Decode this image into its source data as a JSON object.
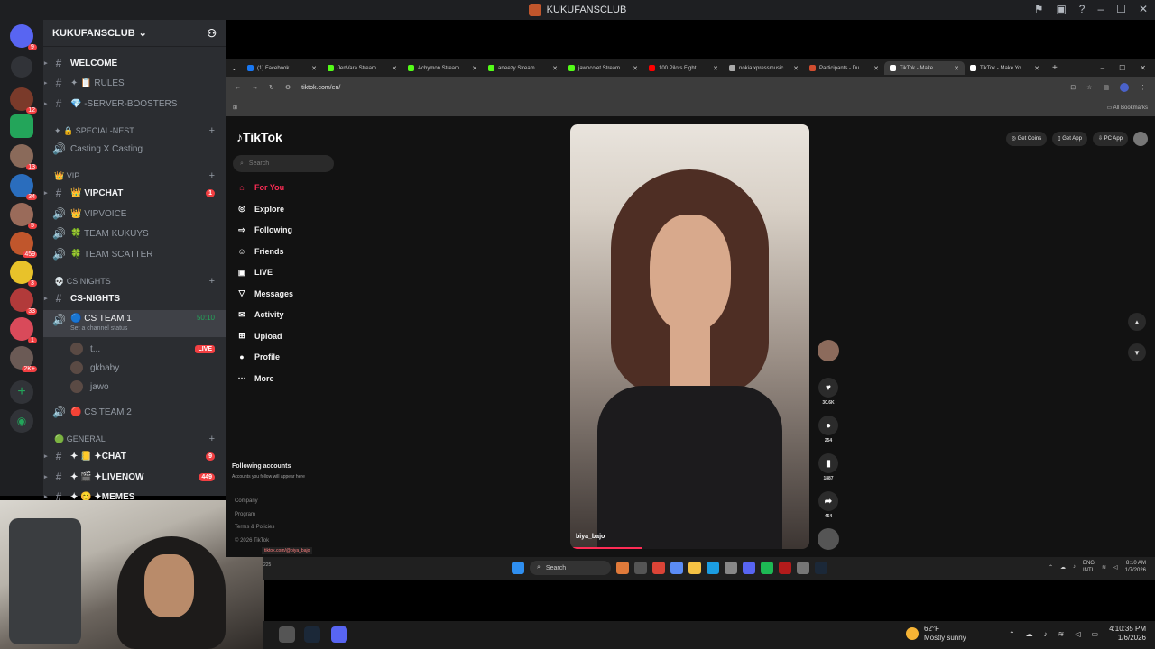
{
  "discord": {
    "window_title": "KUKUFANSCLUB",
    "server_name": "KUKUFANSCLUB",
    "server_badges": [
      "9",
      "12",
      "13",
      "34",
      "5",
      "459",
      "3",
      "33",
      "1",
      "2K+"
    ],
    "channels": [
      {
        "label": "WELCOME",
        "type": "text",
        "bright": true
      },
      {
        "label": "✦ 📋 RULES",
        "type": "text"
      },
      {
        "label": "💎 -SERVER-BOOSTERS",
        "type": "text"
      },
      {
        "label": "✦ 🔒 Special-Nest",
        "type": "category"
      },
      {
        "label": "Casting X Casting",
        "type": "voice"
      },
      {
        "label": "👑 VIP",
        "type": "category"
      },
      {
        "label": "👑 VIPCHAT",
        "type": "text",
        "bright": true,
        "badge": "1"
      },
      {
        "label": "👑 VIPVOICE",
        "type": "voice"
      },
      {
        "label": "🍀 TEAM KUKUYS",
        "type": "voice"
      },
      {
        "label": "🍀 TEAM SCATTER",
        "type": "voice"
      },
      {
        "label": "💀 CS NIGHTS",
        "type": "category"
      },
      {
        "label": "CS-NIGHTS",
        "type": "text",
        "bright": true
      },
      {
        "label": "🔵 CS TEAM 1",
        "type": "voice",
        "active": true,
        "time": "50:10",
        "status": "Set a channel status"
      },
      {
        "label": "t...",
        "type": "member",
        "live": "LIVE"
      },
      {
        "label": "gkbaby",
        "type": "member"
      },
      {
        "label": "jawo",
        "type": "member"
      },
      {
        "label": "🔴 CS TEAM 2",
        "type": "voice"
      },
      {
        "label": "🟢 GENERAL",
        "type": "category"
      },
      {
        "label": "✦ 📒 ✦CHAT",
        "type": "text",
        "bright": true,
        "badge": "9"
      },
      {
        "label": "✦ 🎬 ✦LIVENOW",
        "type": "text",
        "bright": true,
        "badge": "449"
      },
      {
        "label": "✦ 😊 ✦MEMES",
        "type": "text",
        "bright": true
      }
    ]
  },
  "browser": {
    "tabs": [
      {
        "label": "(1) Facebook",
        "color": "#1877f2"
      },
      {
        "label": "JenVara Stream",
        "color": "#53fc18"
      },
      {
        "label": "Achymon Stream",
        "color": "#53fc18"
      },
      {
        "label": "arteezy Stream",
        "color": "#53fc18"
      },
      {
        "label": "jawocolet Stream",
        "color": "#53fc18"
      },
      {
        "label": "100 Pilots Fight",
        "color": "#ff0000"
      },
      {
        "label": "nokia xpressmusic",
        "color": "#aaaaaa"
      },
      {
        "label": "Participants - Du",
        "color": "#d14d2f"
      },
      {
        "label": "TikTok - Make",
        "color": "#ffffff",
        "active": true
      },
      {
        "label": "TikTok - Make Yo",
        "color": "#ffffff"
      }
    ],
    "url": "tiktok.com/en/",
    "all_bookmarks": "All Bookmarks"
  },
  "tiktok": {
    "logo": "TikTok",
    "search_placeholder": "Search",
    "nav": [
      {
        "label": "For You",
        "icon": "⌂",
        "selected": true
      },
      {
        "label": "Explore",
        "icon": "◎"
      },
      {
        "label": "Following",
        "icon": "⇨"
      },
      {
        "label": "Friends",
        "icon": "☺"
      },
      {
        "label": "LIVE",
        "icon": "▣"
      },
      {
        "label": "Messages",
        "icon": "▽"
      },
      {
        "label": "Activity",
        "icon": "✉"
      },
      {
        "label": "Upload",
        "icon": "⊞"
      },
      {
        "label": "Profile",
        "icon": "●"
      },
      {
        "label": "More",
        "icon": "⋯"
      }
    ],
    "following_title": "Following accounts",
    "following_sub": "Accounts you follow will appear here",
    "footer": [
      "Company",
      "Program",
      "Terms & Policies",
      "© 2026 TikTok"
    ],
    "top_buttons": [
      "Get Coins",
      "Get App",
      "PC App"
    ],
    "video_user": "biya_bajo",
    "actions": {
      "likes": "30.6K",
      "comments": "254",
      "saves": "1887",
      "shares": "454"
    },
    "status_link": "tiktok.com/@biya_bajo"
  },
  "inner_taskbar": {
    "search": "Search",
    "left_text": "225",
    "lang": "ENG",
    "lang2": "INTL",
    "time": "8:10 AM",
    "date": "1/7/2026"
  },
  "outer_taskbar": {
    "temp": "62°F",
    "weather": "Mostly sunny",
    "time": "4:10:35 PM",
    "date": "1/6/2026"
  }
}
